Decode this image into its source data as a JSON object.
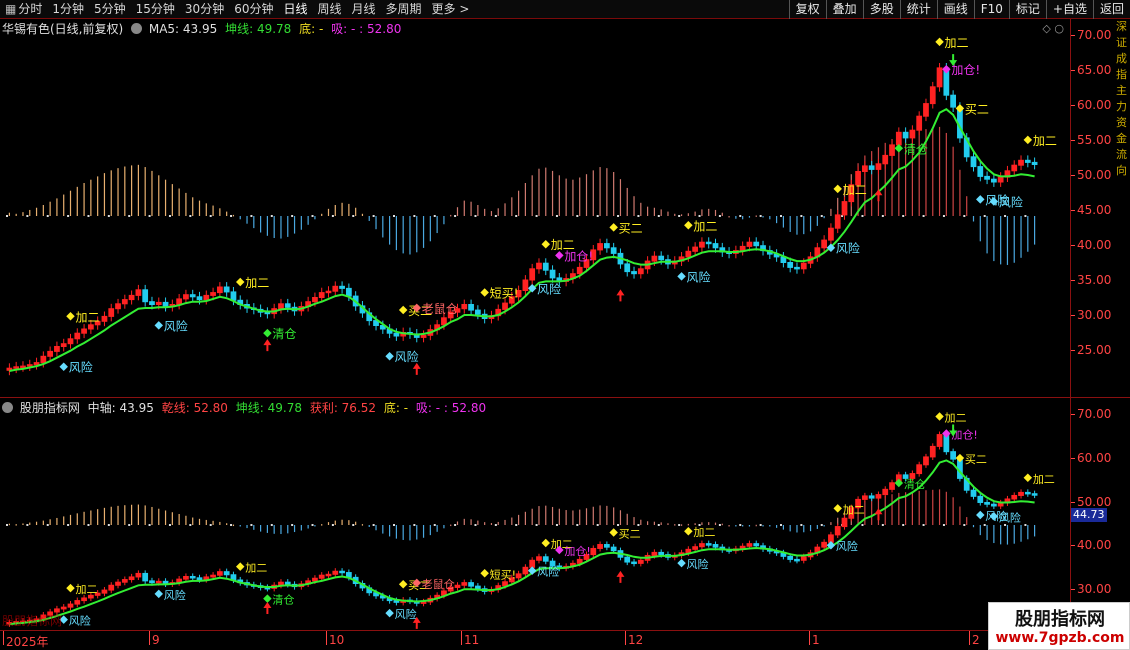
{
  "toolbar": {
    "periods": [
      {
        "label": "分时",
        "icon": "grid-icon"
      },
      {
        "label": "1分钟"
      },
      {
        "label": "5分钟"
      },
      {
        "label": "15分钟"
      },
      {
        "label": "30分钟"
      },
      {
        "label": "60分钟"
      },
      {
        "label": "日线",
        "active": true
      },
      {
        "label": "周线"
      },
      {
        "label": "月线"
      },
      {
        "label": "多周期"
      },
      {
        "label": "更多 >"
      }
    ],
    "right_buttons": [
      "复权",
      "叠加",
      "多股",
      "统计",
      "画线",
      "F10",
      "标记",
      "+自选",
      "返回"
    ]
  },
  "panel1": {
    "title": "华锡有色(日线,前复权)",
    "ma5": "MA5: 43.95",
    "kun": "坤线: 49.78",
    "di": "底: -",
    "xi": "吸: - : 52.80",
    "yaxis": [
      "70.00",
      "65.00",
      "60.00",
      "55.00",
      "50.00",
      "45.00",
      "40.00",
      "35.00",
      "30.00",
      "25.00"
    ]
  },
  "panel2": {
    "title": "股朋指标网",
    "zhongzhou": "中轴: 43.95",
    "qian": "乾线: 52.80",
    "kun": "坤线: 49.78",
    "huoli": "获利: 76.52",
    "di": "底: -",
    "xi": "吸: - : 52.80",
    "yaxis": [
      "70.00",
      "60.00",
      "50.00",
      "40.00",
      "30.00"
    ],
    "price_tag": "44.73"
  },
  "dates": [
    "2025年",
    "9",
    "10",
    "11",
    "12",
    "1",
    "2"
  ],
  "watermark": {
    "title": "股朋指标网",
    "url": "www.7gpzb.com",
    "overlay": "股朋指标网"
  },
  "side_text": "深证成指主力资金流向",
  "signals": {
    "risk": "风险",
    "add2": "加二",
    "clear": "清仓",
    "buy2": "买二",
    "addpos": "加仓!",
    "mouse": "老鼠仓",
    "short_buy": "短买!",
    "short_buy_arrow": "←短买!"
  },
  "colors": {
    "up": "#ff2222",
    "down": "#22ccee",
    "kun_line": "#33ee33",
    "bg": "#000000",
    "axis": "#ff4444"
  },
  "chart_data": {
    "type": "candlestick",
    "title": "华锡有色(日线,前复权)",
    "ylim": [
      20,
      72
    ],
    "closes": [
      22.4,
      22.6,
      22.7,
      22.9,
      23.2,
      24.1,
      24.8,
      25.5,
      25.9,
      26.6,
      27.4,
      28.0,
      28.6,
      29.1,
      29.8,
      30.9,
      31.6,
      32.2,
      32.8,
      33.6,
      31.9,
      31.5,
      31.8,
      31.2,
      31.5,
      32.3,
      32.9,
      32.6,
      32.2,
      32.8,
      33.2,
      34.0,
      33.3,
      32.1,
      31.5,
      31.0,
      30.8,
      30.4,
      30.2,
      30.9,
      31.6,
      31.1,
      30.6,
      31.2,
      31.9,
      32.5,
      33.2,
      33.4,
      34.1,
      33.8,
      32.7,
      31.3,
      30.3,
      29.2,
      28.5,
      28.0,
      27.4,
      27.0,
      27.5,
      27.3,
      26.8,
      27.1,
      27.9,
      28.6,
      29.6,
      30.4,
      30.9,
      31.5,
      30.7,
      30.1,
      29.5,
      29.9,
      30.8,
      31.7,
      32.6,
      33.5,
      35.0,
      36.6,
      37.4,
      36.4,
      35.3,
      34.8,
      35.2,
      35.9,
      36.8,
      37.9,
      39.3,
      40.2,
      39.6,
      38.8,
      37.3,
      36.2,
      35.9,
      36.6,
      37.7,
      38.4,
      37.9,
      37.3,
      37.7,
      38.3,
      39.1,
      39.7,
      40.4,
      40.2,
      39.6,
      39.0,
      38.8,
      39.2,
      39.8,
      40.4,
      39.9,
      39.2,
      38.7,
      38.3,
      37.5,
      36.8,
      36.6,
      37.4,
      38.3,
      39.6,
      40.7,
      42.4,
      44.3,
      46.2,
      48.6,
      50.5,
      51.3,
      50.8,
      51.6,
      52.8,
      54.3,
      56.1,
      55.3,
      56.4,
      58.4,
      60.2,
      62.6,
      65.3,
      61.4,
      59.7,
      55.3,
      52.6,
      51.2,
      49.8,
      49.4,
      49.0,
      49.7,
      50.6,
      51.4,
      52.1,
      51.8,
      51.5
    ],
    "kun_line": [
      22.0,
      22.2,
      22.3,
      22.5,
      22.7,
      23.0,
      23.4,
      23.9,
      24.4,
      24.9,
      25.5,
      26.0,
      26.6,
      27.2,
      27.8,
      28.5,
      29.1,
      29.7,
      30.3,
      30.9,
      31.0,
      31.0,
      31.1,
      31.1,
      31.2,
      31.4,
      31.7,
      31.9,
      31.9,
      32.0,
      32.3,
      32.6,
      32.4,
      32.0,
      31.5,
      31.2,
      30.9,
      30.6,
      30.5,
      30.5,
      30.8,
      30.9,
      30.8,
      30.9,
      31.2,
      31.6,
      31.9,
      32.3,
      32.7,
      32.9,
      32.6,
      31.9,
      31.1,
      30.2,
      29.4,
      28.7,
      28.0,
      27.6,
      27.4,
      27.3,
      27.2,
      27.3,
      27.5,
      27.9,
      28.4,
      29.0,
      29.4,
      30.0,
      30.0,
      29.9,
      29.8,
      29.8,
      30.0,
      30.5,
      31.1,
      31.8,
      32.7,
      33.7,
      34.6,
      34.8,
      34.8,
      34.8,
      34.9,
      35.2,
      35.6,
      36.3,
      37.1,
      37.9,
      38.2,
      38.3,
      38.1,
      37.8,
      37.4,
      37.2,
      37.2,
      37.4,
      37.6,
      37.6,
      37.6,
      37.8,
      38.1,
      38.5,
      38.9,
      39.1,
      39.1,
      39.1,
      39.0,
      39.0,
      39.1,
      39.3,
      39.4,
      39.3,
      39.1,
      38.8,
      38.4,
      38.0,
      37.7,
      37.7,
      37.9,
      38.3,
      38.9,
      39.7,
      40.7,
      41.9,
      43.3,
      44.8,
      46.1,
      46.7,
      47.6,
      48.5,
      49.6,
      50.8,
      51.2,
      52.1,
      53.2,
      54.8,
      56.7,
      58.9,
      59.4,
      58.6,
      56.8,
      55.1,
      53.4,
      52.0,
      50.9,
      50.1,
      49.8,
      49.8,
      49.9,
      50.1,
      50.0,
      49.8
    ],
    "macd_hist": [
      0.6,
      0.4,
      0.7,
      1.1,
      1.5,
      2.0,
      2.6,
      3.2,
      3.9,
      4.6,
      5.3,
      6.0,
      6.6,
      7.2,
      7.8,
      8.3,
      8.7,
      9.0,
      9.2,
      9.3,
      8.9,
      8.2,
      7.4,
      6.6,
      5.8,
      5.0,
      4.2,
      3.4,
      2.8,
      2.3,
      1.9,
      1.4,
      0.8,
      0.2,
      -0.6,
      -1.4,
      -2.2,
      -3.0,
      -3.6,
      -4.0,
      -4.1,
      -3.8,
      -3.2,
      -2.5,
      -1.6,
      -0.6,
      0.4,
      1.3,
      2.0,
      2.4,
      2.2,
      1.5,
      0.4,
      -0.9,
      -2.4,
      -3.9,
      -5.2,
      -6.2,
      -6.8,
      -7.0,
      -6.6,
      -5.8,
      -4.6,
      -3.1,
      -1.5,
      0.2,
      1.6,
      2.8,
      2.6,
      2.0,
      1.3,
      0.9,
      1.4,
      2.3,
      3.4,
      4.6,
      6.0,
      7.4,
      8.6,
      8.8,
      8.2,
      7.4,
      6.8,
      6.6,
      7.0,
      7.6,
      8.3,
      8.9,
      8.7,
      8.0,
      6.7,
      5.1,
      3.6,
      2.4,
      1.7,
      1.5,
      1.2,
      0.8,
      0.4,
      0.3,
      0.5,
      0.8,
      1.2,
      1.3,
      1.1,
      0.6,
      0.0,
      -0.5,
      -0.6,
      -0.3,
      0.1,
      -0.1,
      -0.6,
      -1.3,
      -2.1,
      -2.9,
      -3.4,
      -3.3,
      -2.8,
      -1.8,
      -0.4,
      1.3,
      3.3,
      5.4,
      7.6,
      9.6,
      11.0,
      11.8,
      12.5,
      13.3,
      14.0,
      14.6,
      14.9,
      15.2,
      15.5,
      15.8,
      16.0,
      16.2,
      15.1,
      12.6,
      8.4,
      3.6,
      -1.0,
      -4.6,
      -6.8,
      -8.2,
      -8.8,
      -8.9,
      -8.5,
      -7.6,
      -6.5,
      -5.2
    ]
  }
}
